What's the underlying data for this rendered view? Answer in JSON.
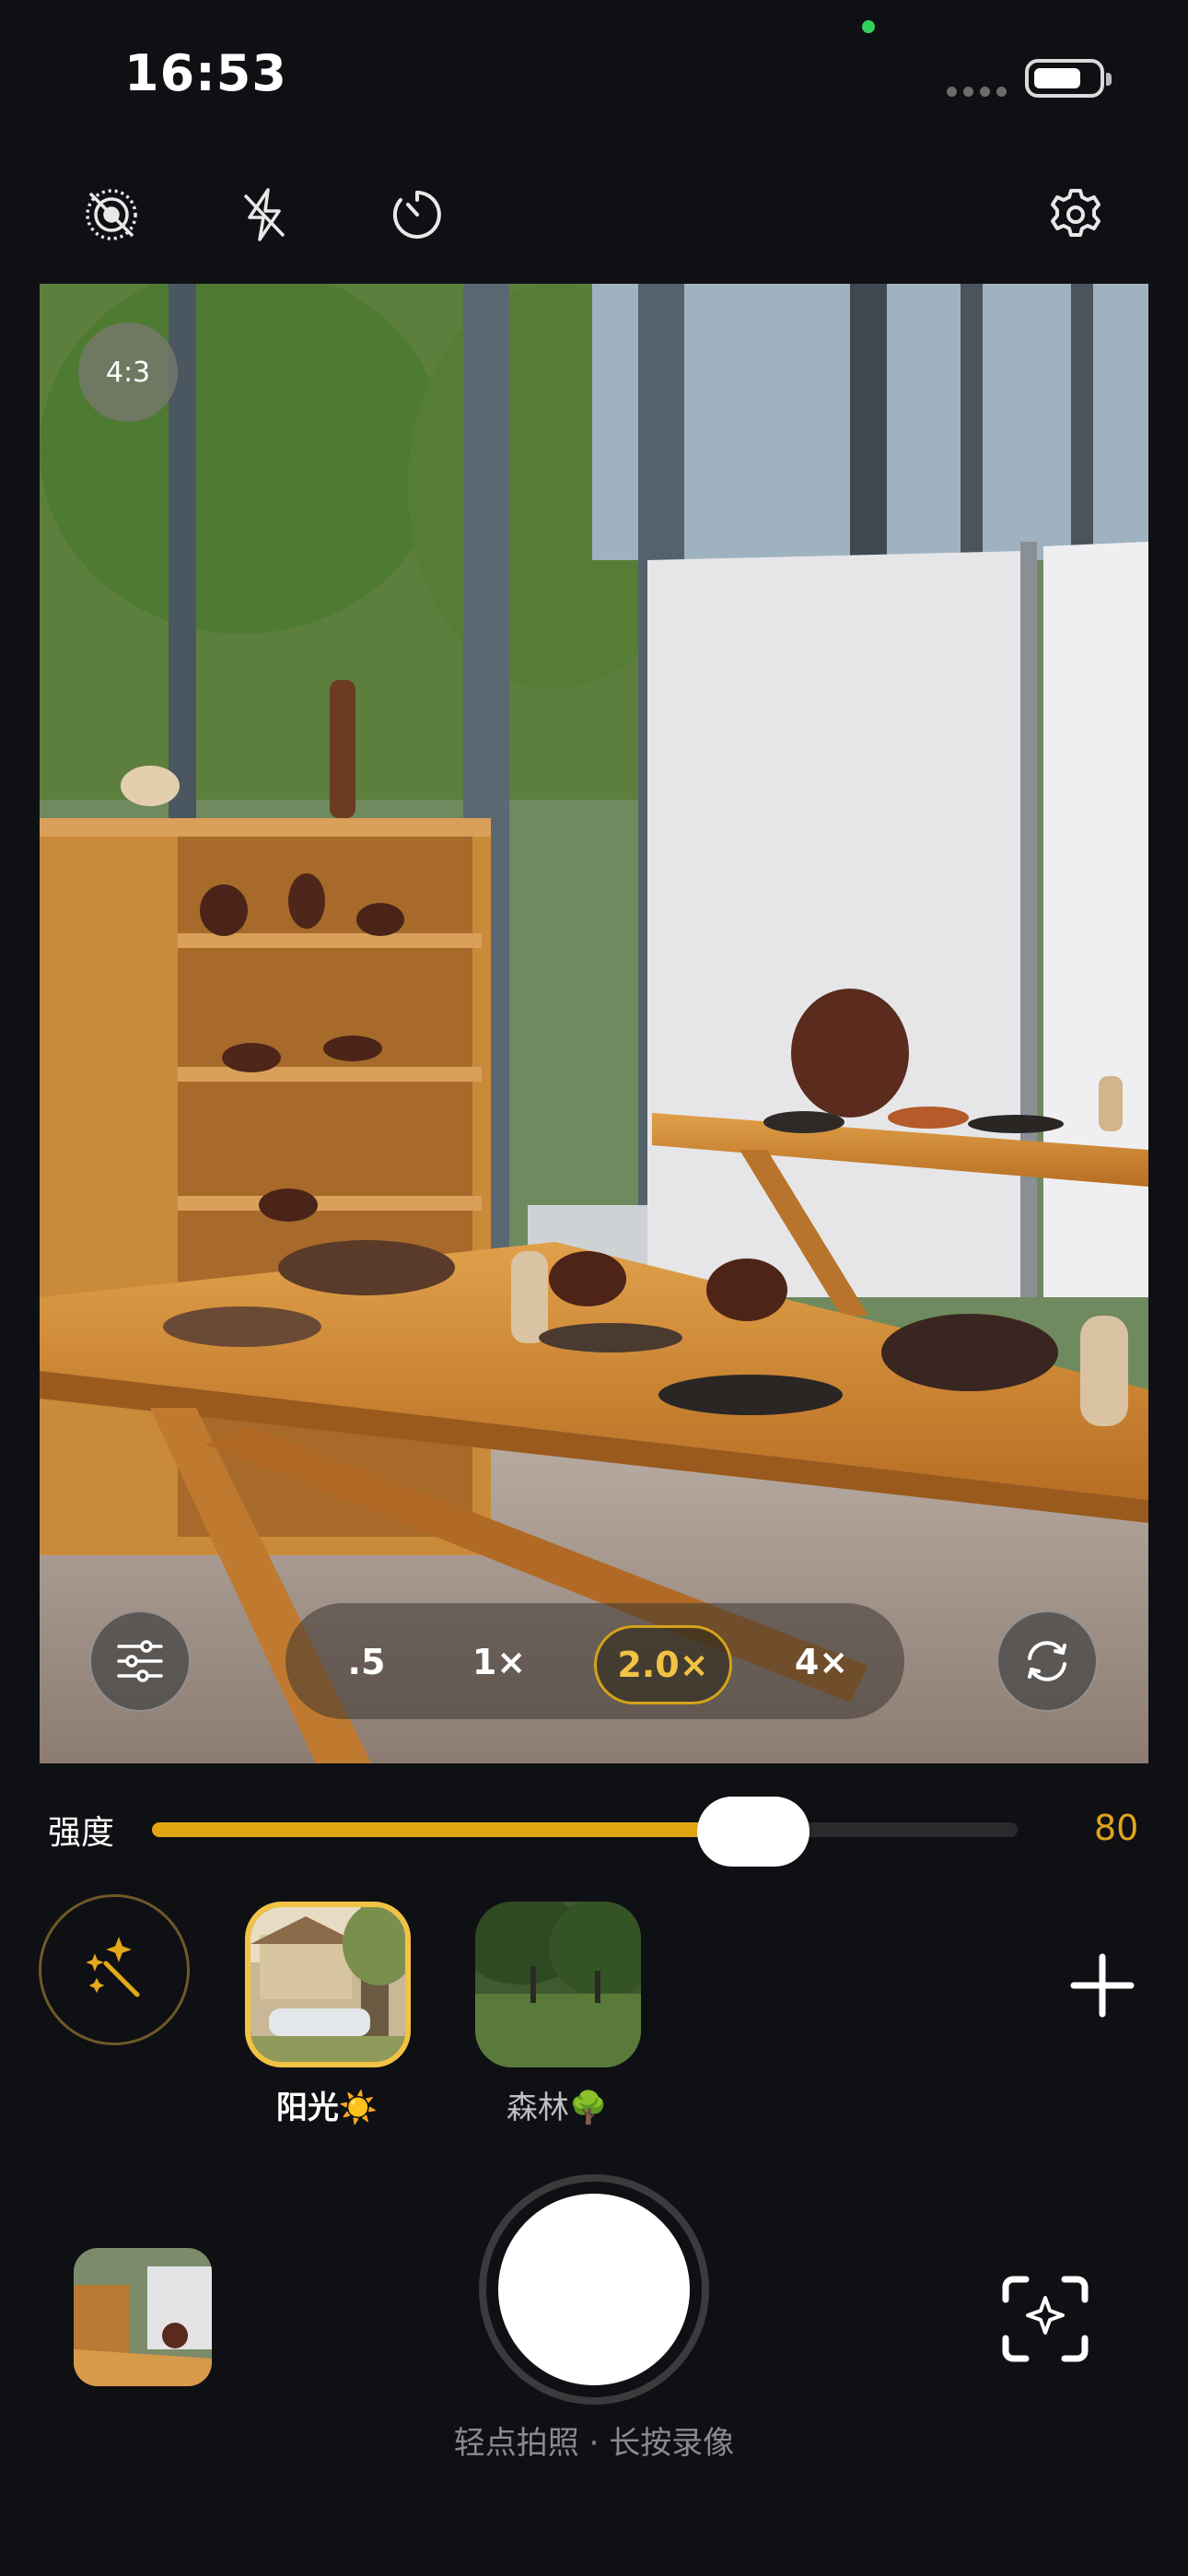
{
  "status_bar": {
    "time": "16:53"
  },
  "top_bar": {
    "icons": [
      "live-photo-off-icon",
      "flash-off-icon",
      "timer-icon",
      "gear-icon"
    ]
  },
  "viewfinder": {
    "aspect_ratio": "4:3",
    "zoom_options": [
      ".5",
      "1×",
      "2.0×",
      "4×"
    ],
    "selected_zoom": "2.0×"
  },
  "intensity": {
    "label": "强度",
    "value": "80",
    "fraction": 0.8
  },
  "filters": [
    {
      "label": "阳光",
      "emoji": "☀️",
      "selected": true
    },
    {
      "label": "森林",
      "emoji": "🌳",
      "selected": false
    }
  ],
  "hint": "轻点拍照 · 长按录像",
  "colors": {
    "accent": "#e1a514",
    "background": "#0f1014"
  }
}
